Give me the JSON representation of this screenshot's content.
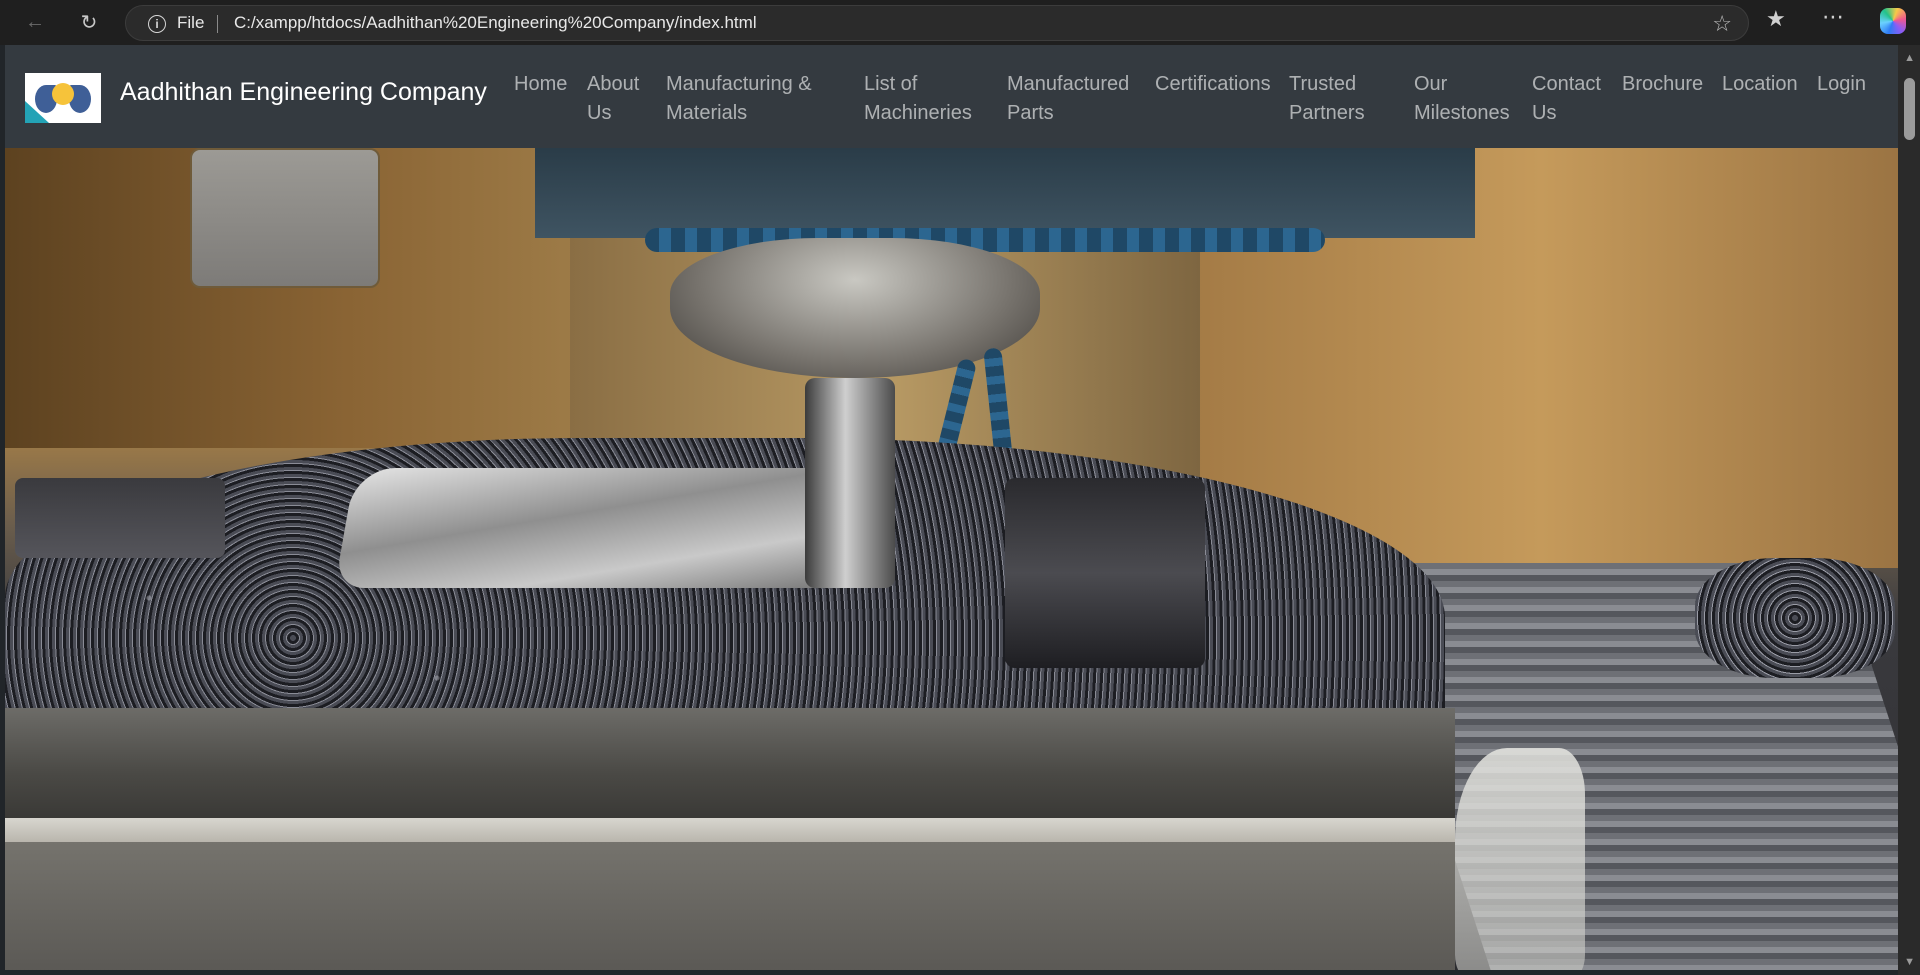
{
  "browser": {
    "scheme_label": "File",
    "url": "C:/xampp/htdocs/Aadhithan%20Engineering%20Company/index.html",
    "icons": [
      "back-arrow-icon",
      "reload-icon",
      "info-icon",
      "star-icon",
      "favorites-icon",
      "more-icon",
      "copilot-icon"
    ]
  },
  "navbar": {
    "brand": "Aadhithan Engineering Company",
    "links": [
      {
        "line1": "Home",
        "line2": ""
      },
      {
        "line1": "About",
        "line2": "Us"
      },
      {
        "line1": "Manufacturing &",
        "line2": "Materials"
      },
      {
        "line1": "List of",
        "line2": "Machineries"
      },
      {
        "line1": "Manufactured",
        "line2": "Parts"
      },
      {
        "line1": "Certifications",
        "line2": ""
      },
      {
        "line1": "Trusted",
        "line2": "Partners"
      },
      {
        "line1": "Our",
        "line2": "Milestones"
      },
      {
        "line1": "Contact",
        "line2": "Us"
      },
      {
        "line1": "Brochure",
        "line2": ""
      },
      {
        "line1": "Location",
        "line2": ""
      },
      {
        "line1": "Login",
        "line2": ""
      }
    ]
  },
  "colors": {
    "navbar_bg": "#343a40",
    "nav_link": "rgba(255,255,255,0.6)",
    "browser_bg": "#1f1f1f"
  }
}
